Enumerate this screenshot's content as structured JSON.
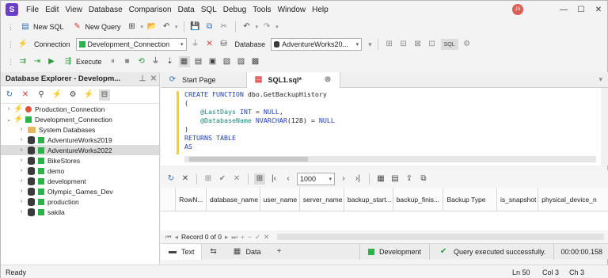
{
  "menu": [
    "File",
    "Edit",
    "View",
    "Database",
    "Comparison",
    "Data",
    "SQL",
    "Debug",
    "Tools",
    "Window",
    "Help"
  ],
  "user_initials": "JS",
  "toolbar1": {
    "new_sql": "New SQL",
    "new_query": "New Query"
  },
  "toolbar2": {
    "connection_label": "Connection",
    "connection_value": "Development_Connection",
    "database_label": "Database",
    "database_value": "AdventureWorks20..."
  },
  "toolbar3": {
    "execute": "Execute"
  },
  "explorer": {
    "title": "Database Explorer - Developm...",
    "items": [
      {
        "label": "Production_Connection",
        "type": "conn-red",
        "level": 0,
        "expander": "›"
      },
      {
        "label": "Development_Connection",
        "type": "conn-green",
        "level": 0,
        "expander": "⌄"
      },
      {
        "label": "System Databases",
        "type": "folder",
        "level": 1,
        "expander": "›"
      },
      {
        "label": "AdventureWorks2019",
        "type": "db",
        "level": 1,
        "expander": "›"
      },
      {
        "label": "AdventureWorks2022",
        "type": "db",
        "level": 1,
        "expander": "›",
        "selected": true
      },
      {
        "label": "BikeStores",
        "type": "db",
        "level": 1,
        "expander": "›"
      },
      {
        "label": "demo",
        "type": "db",
        "level": 1,
        "expander": "›"
      },
      {
        "label": "development",
        "type": "db",
        "level": 1,
        "expander": "›"
      },
      {
        "label": "Olympic_Games_Dev",
        "type": "db",
        "level": 1,
        "expander": "›"
      },
      {
        "label": "production",
        "type": "db",
        "level": 1,
        "expander": "›"
      },
      {
        "label": "sakila",
        "type": "db",
        "level": 1,
        "expander": "›"
      }
    ]
  },
  "tabs": {
    "start": "Start Page",
    "sql": "SQL1.sql*"
  },
  "code": {
    "l1a": "CREATE FUNCTION",
    "l1b": " dbo.GetBackupHistory",
    "l2": "(",
    "l3a": "    @LastDays",
    "l3b": " INT",
    "l3c": " = ",
    "l3d": "NULL",
    ",": ",",
    "l4a": "    @DatabaseName",
    "l4b": " NVARCHAR",
    "l4c": "(128) = ",
    "l4d": "NULL",
    "l5": ")",
    "l6": "RETURNS TABLE",
    "l7": "AS"
  },
  "results": {
    "page_size": "1000",
    "columns": [
      "RowN...",
      "database_name",
      "user_name",
      "server_name",
      "backup_start...",
      "backup_finis...",
      "Backup Type",
      "is_snapshot",
      "physical_device_n"
    ],
    "record": "Record 0 of 0",
    "tab_text": "Text",
    "tab_data": "Data",
    "conn_status": "Development",
    "exec_status": "Query executed successfully.",
    "elapsed": "00:00:00.158"
  },
  "status": {
    "ready": "Ready",
    "ln": "Ln 50",
    "col": "Col 3",
    "ch": "Ch 3"
  }
}
